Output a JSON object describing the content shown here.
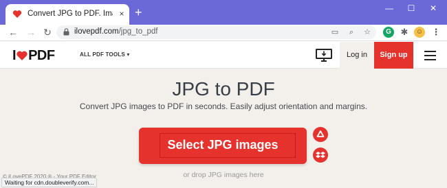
{
  "browser": {
    "tab_title": "Convert JPG to PDF. Images JPG",
    "tab_close": "×",
    "new_tab": "+",
    "window_controls": {
      "minimize": "—",
      "maximize": "☐",
      "close": "✕"
    },
    "url_domain": "ilovepdf.com",
    "url_path": "/jpg_to_pdf",
    "status_text": "Waiting for cdn.doubleverify.com..."
  },
  "site": {
    "logo_left": "I",
    "logo_right": "PDF",
    "nav_label": "ALL PDF TOOLS",
    "login_label": "Log in",
    "signup_label": "Sign up",
    "brand_color": "#e5322d"
  },
  "main": {
    "title": "JPG to PDF",
    "subtitle": "Convert JPG images to PDF in seconds. Easily adjust orientation and margins.",
    "select_button": "Select JPG images",
    "drop_text": "or drop JPG images here",
    "footer_text": "© iLovePDF 2020 ® - Your PDF Editor"
  }
}
